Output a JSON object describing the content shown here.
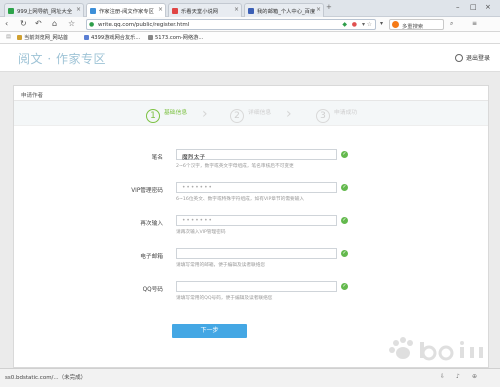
{
  "browser": {
    "tabs": [
      {
        "label": "999上网导航_网址大全",
        "color": "#2da34a"
      },
      {
        "label": "作家注册-阅文作家专区",
        "color": "#3d8fd8"
      },
      {
        "label": "乐看天堂小说网",
        "color": "#e04545"
      },
      {
        "label": "我的邮箱_个人中心_百度",
        "color": "#3b5fb5"
      }
    ],
    "window_controls": [
      "–",
      "□",
      "×"
    ],
    "address": "write.qq.com/public/register.html",
    "search_placeholder": "多重搜索",
    "bookmarks": [
      {
        "label": "当前浏览网_网站首",
        "color": "#d0a030"
      },
      {
        "label": "4399游戏网合友乐...",
        "color": "#5b7fd3"
      },
      {
        "label": "5173.com-网络游...",
        "color": "#888888"
      }
    ],
    "status_text": "ss0.bdstatic.com/...（未完成）"
  },
  "header": {
    "logo": "阅文 · 作家专区",
    "logout": "退出登录"
  },
  "card": {
    "title": "申请作者",
    "steps": [
      {
        "num": "1",
        "label": "基础信息",
        "state": "active"
      },
      {
        "num": "2",
        "label": "详细信息",
        "state": "inactive"
      },
      {
        "num": "3",
        "label": "申请成功",
        "state": "inactive"
      }
    ]
  },
  "form": {
    "pen_name": {
      "label": "笔名",
      "value": "魔烈太子",
      "hint": "2~6个汉字，数字或英文字母组成，笔名审核后不可变更"
    },
    "vip_password": {
      "label": "VIP管理密码",
      "value": "•••••••",
      "hint": "6~16位英文、数字或特殊字符组成，如有VIP章节的需要输入"
    },
    "confirm_password": {
      "label": "再次输入",
      "value": "•••••••",
      "hint": "请再次输入VIP管理密码"
    },
    "email": {
      "label": "电子邮箱",
      "value": "",
      "hint": "请填写常用的邮箱，便于编辑及读者联络您"
    },
    "qq": {
      "label": "QQ号码",
      "value": "",
      "hint": "请填写常用的QQ号码，便于编辑及读者联络您"
    },
    "next_button": "下一步"
  },
  "colors": {
    "accent_green": "#7dc243",
    "button_blue": "#44a7e4",
    "check_green": "#63b94d"
  }
}
